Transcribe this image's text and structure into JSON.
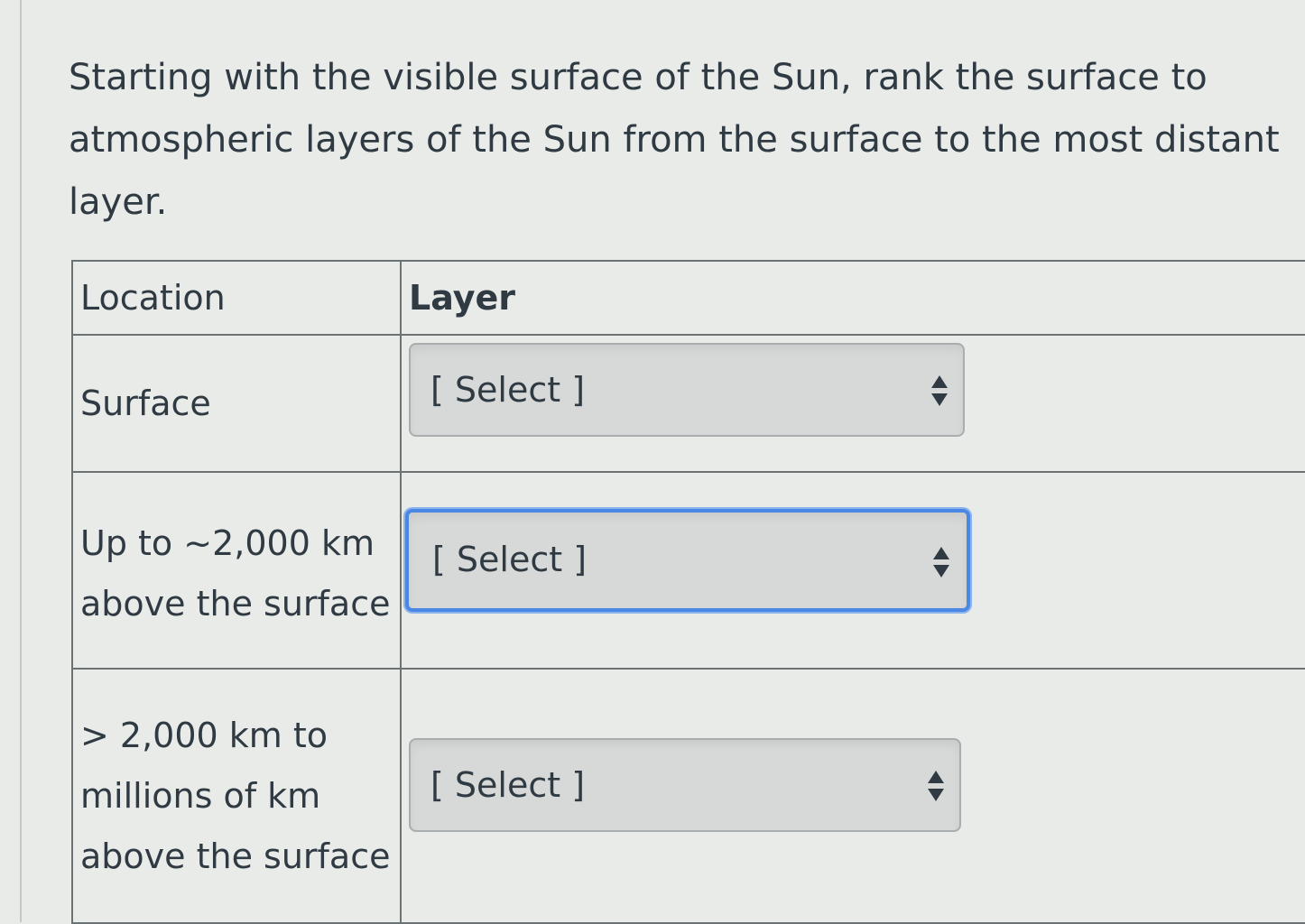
{
  "question": {
    "text": "Starting with the visible surface of the Sun, rank the surface to atmospheric layers of the Sun from the surface to the most distant layer."
  },
  "table": {
    "headers": {
      "location": "Location",
      "layer": "Layer"
    },
    "rows": [
      {
        "location": "Surface",
        "select_value": "[ Select ]"
      },
      {
        "location": "Up to ~2,000 km above the surface",
        "select_value": "[ Select ]"
      },
      {
        "location": "> 2,000 km to millions of km above the surface",
        "select_value": "[ Select ]"
      }
    ]
  },
  "icons": {
    "select_arrows": "up-down-arrows-icon"
  },
  "colors": {
    "focus_ring": "#4a88e4",
    "text": "#2f3a42",
    "select_background": "#d6d9d8"
  }
}
